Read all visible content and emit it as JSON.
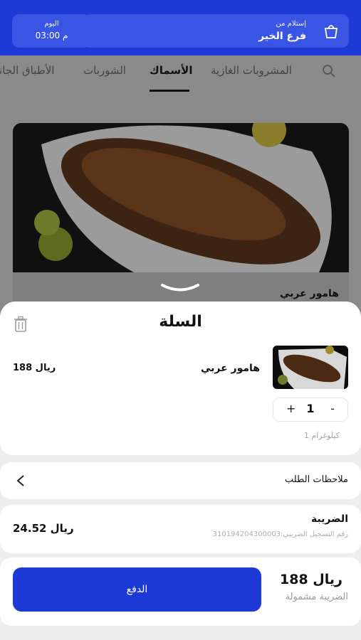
{
  "header": {
    "pickup_label": "إستلام من",
    "pickup_value": "فرع الخير",
    "time_label": "اليوم",
    "time_value": "03:00 م"
  },
  "tabs": [
    {
      "label": "المشروبات الغازية"
    },
    {
      "label": "الأسماك"
    },
    {
      "label": "الشوربات"
    },
    {
      "label": "الأطباق الجانبية"
    }
  ],
  "background_item": {
    "name": "هامور عربي"
  },
  "cart": {
    "title": "السلة",
    "item": {
      "name": "هامور عربي",
      "price": "188 ريال",
      "quantity": "1",
      "minus": "-",
      "plus": "+",
      "unit": "1 كيلوغرام"
    }
  },
  "notes": {
    "label": "ملاحظات الطلب"
  },
  "tax": {
    "label": "الضريبة",
    "reg_label": "رقم التسجيل الضريبي:",
    "reg_number": "310194204300003",
    "value": "24.52 ريال"
  },
  "payment": {
    "total": "188 ريال",
    "total_note": "الضريبة مشمولة",
    "button_label": "الدفع"
  },
  "colors": {
    "accent": "#1d3ad6"
  }
}
